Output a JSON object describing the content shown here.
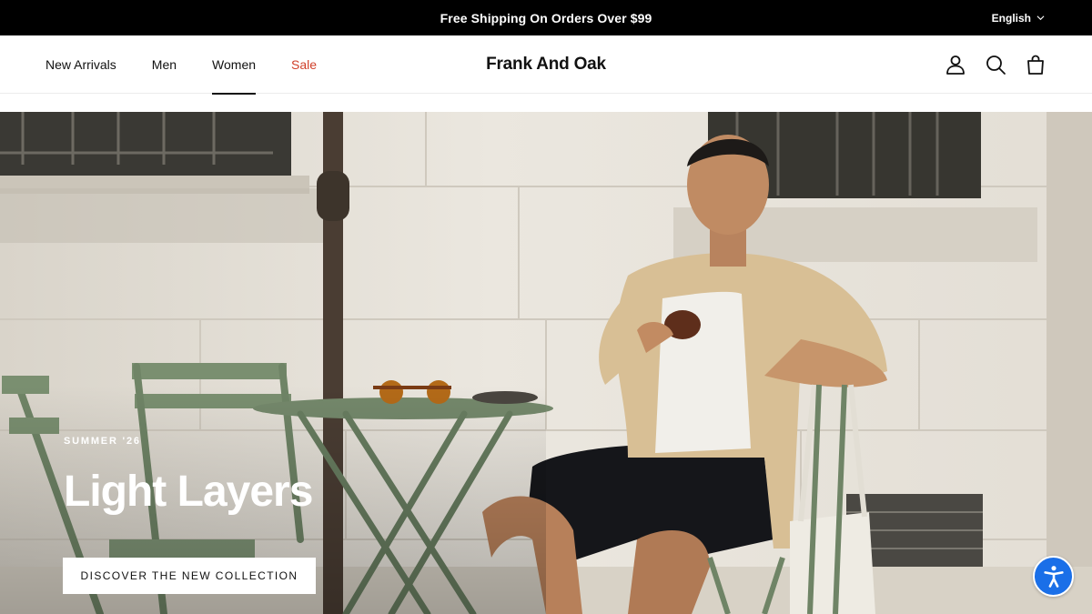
{
  "announcement": {
    "text": "Free Shipping On Orders Over $99"
  },
  "language": {
    "label": "English"
  },
  "nav": {
    "items": [
      {
        "label": "New Arrivals"
      },
      {
        "label": "Men"
      },
      {
        "label": "Women"
      },
      {
        "label": "Sale"
      }
    ],
    "active": "Women"
  },
  "brand": {
    "name": "Frank And Oak"
  },
  "header_icons": [
    "account-icon",
    "search-icon",
    "cart-icon"
  ],
  "hero": {
    "eyebrow": "SUMMER '26",
    "headline": "Light Layers",
    "cta_label": "DISCOVER THE NEW COLLECTION"
  },
  "accessibility": {
    "icon": "accessibility-icon"
  },
  "colors": {
    "sale": "#d0402a",
    "announcement_bg": "#000000",
    "accessibility": "#1a6fe8"
  }
}
